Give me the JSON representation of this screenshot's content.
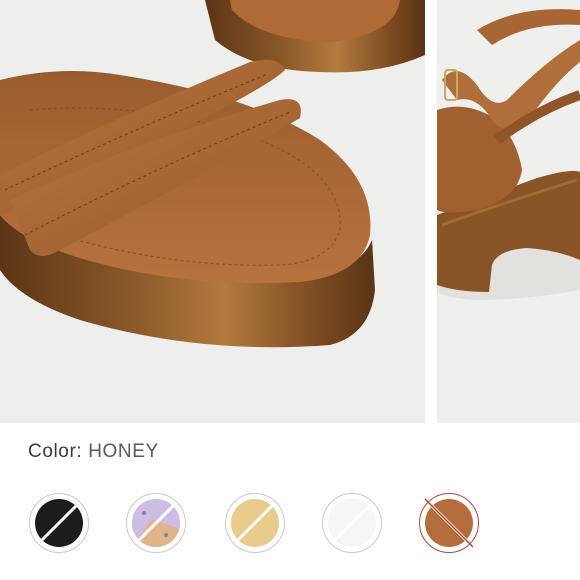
{
  "product": {
    "color_label": "Color:",
    "color_value": "HONEY",
    "selected_color": "HONEY"
  },
  "swatches": [
    {
      "id": "black",
      "color": "#1c1c1c"
    },
    {
      "id": "lavender-print",
      "color": "#b9a6d6"
    },
    {
      "id": "cream",
      "color": "#e9cc8c"
    },
    {
      "id": "white",
      "color": "#f6f6f6"
    },
    {
      "id": "honey",
      "color": "#b46d3d",
      "unavailable": true
    }
  ],
  "colors": {
    "leather": "#a0602f",
    "wood": "#7a4a22",
    "photo_bg": "#eeeeec",
    "accent_red": "#b04a3c"
  }
}
